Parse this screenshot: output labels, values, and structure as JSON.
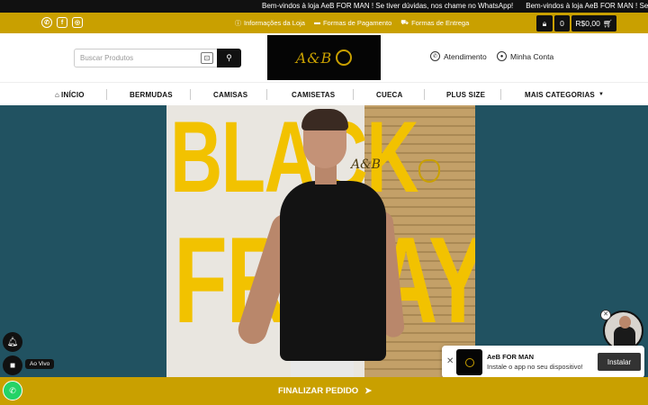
{
  "announcement": {
    "text": "Bem-vindos à loja AeB FOR MAN ! Se tiver dúvidas, nos chame no WhatsApp!",
    "repeat_text": "Bem-vindos à loja AeB FOR MAN ! Se tiver d"
  },
  "topbar": {
    "social": [
      "whatsapp-icon",
      "facebook-icon",
      "instagram-icon"
    ],
    "links": [
      {
        "label": "Informações da Loja",
        "icon": "info-icon"
      },
      {
        "label": "Formas de Pagamento",
        "icon": "card-icon"
      },
      {
        "label": "Formas de Entrega",
        "icon": "truck-icon"
      }
    ],
    "cart_count": "0",
    "cart_total": "R$0,00"
  },
  "header": {
    "search_placeholder": "Buscar Produtos",
    "logo_text": "A&B",
    "atendimento": "Atendimento",
    "minha_conta": "Minha Conta"
  },
  "nav": {
    "items": [
      "INÍCIO",
      "BERMUDAS",
      "CAMISAS",
      "CAMISETAS",
      "CUECA",
      "PLUS SIZE",
      "MAIS CATEGORIAS"
    ]
  },
  "hero": {
    "word1": "BLACK",
    "word2": "FRIDAY",
    "watermark": "A&B"
  },
  "widgets": {
    "live_label": "Ao Vivo",
    "finalize": "FINALIZAR PEDIDO",
    "install_name": "AeB FOR MAN",
    "install_desc": "Instale o app no seu dispositivo!",
    "install_button": "Instalar"
  },
  "colors": {
    "brand_gold": "#c9a000",
    "dark": "#111111",
    "hero_bg": "#215261"
  }
}
